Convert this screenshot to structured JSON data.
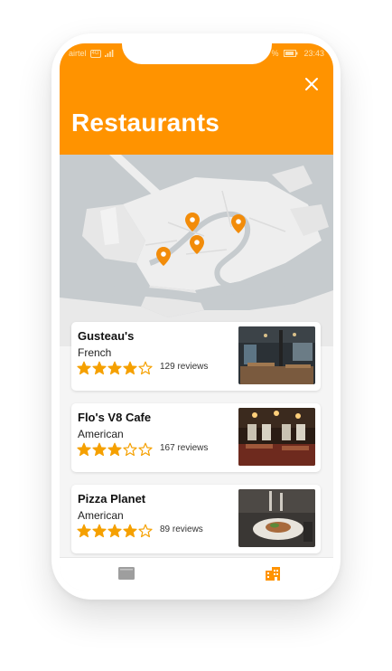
{
  "status_bar": {
    "carrier": "airtel",
    "network_tag": "4G",
    "battery_label": "%",
    "time": "23:43"
  },
  "header": {
    "title": "Restaurants",
    "close_icon": "close-icon",
    "color": "#FF9300"
  },
  "map": {
    "pin_icon": "map-pin-icon",
    "pin_color": "#F28C0A",
    "pin_count": 4
  },
  "restaurants": [
    {
      "name": "Gusteau's",
      "cuisine": "French",
      "rating": 4,
      "max_rating": 5,
      "reviews": "129 reviews",
      "photo": "restaurant-interior-photo"
    },
    {
      "name": "Flo's V8 Cafe",
      "cuisine": "American",
      "rating": 3,
      "max_rating": 5,
      "reviews": "167 reviews",
      "photo": "cafe-interior-photo"
    },
    {
      "name": "Pizza Planet",
      "cuisine": "American",
      "rating": 4,
      "max_rating": 5,
      "reviews": "89 reviews",
      "photo": "plated-dish-photo"
    }
  ],
  "bottom_nav": [
    {
      "icon": "list-icon",
      "active": false
    },
    {
      "icon": "business-icon",
      "active": true
    }
  ],
  "colors": {
    "accent": "#FF9300",
    "star": "#F5A000",
    "inactive_icon": "#9e9e9e"
  }
}
